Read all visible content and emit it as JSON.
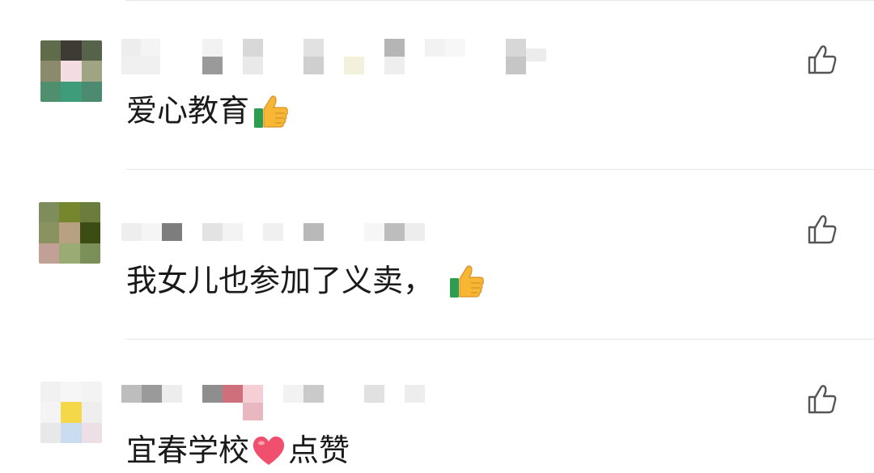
{
  "comments": [
    {
      "text": "爱心教育",
      "emoji": "thumbs-up-icon",
      "trailing": ""
    },
    {
      "text": "我女儿也参加了义卖，",
      "emoji": "thumbs-up-icon",
      "trailing": ""
    },
    {
      "text": "宜春学校",
      "emoji": "heart-icon",
      "trailing": "点赞"
    }
  ],
  "colors": {
    "text": "#1a1a1a",
    "divider": "#e8e8e8",
    "like_icon": "#555555",
    "thumb_yellow": "#f7b733",
    "thumb_green": "#2e9d4f",
    "heart": "#f0506e"
  }
}
